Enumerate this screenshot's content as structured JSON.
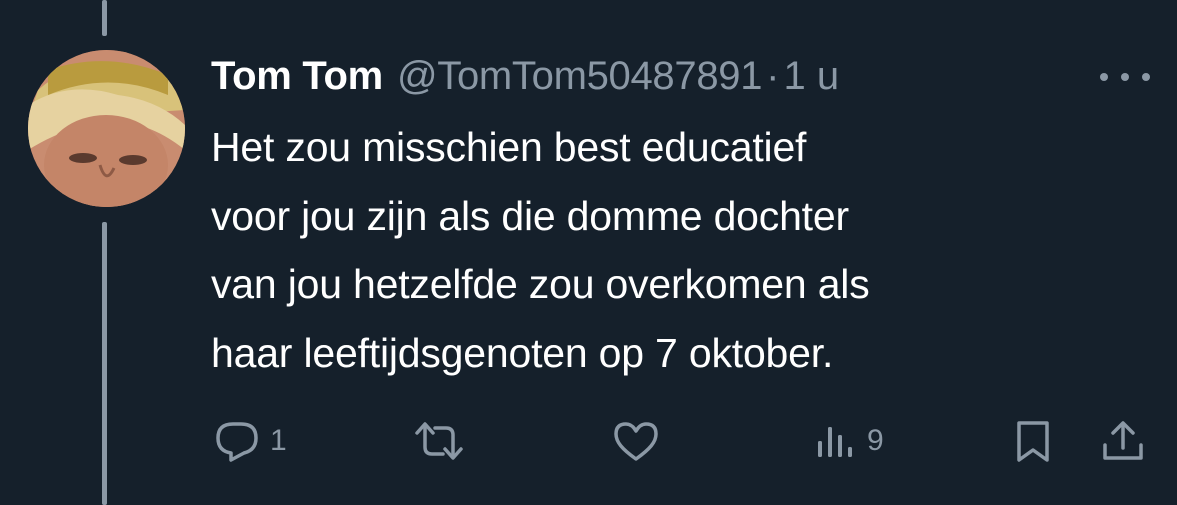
{
  "tweet": {
    "display_name": "Tom Tom",
    "handle": "@TomTom50487891",
    "separator": "·",
    "time": "1 u",
    "text_lines": [
      "Het zou misschien best educatief",
      "voor jou zijn als die domme dochter",
      "van jou hetzelfde zou overkomen als",
      "haar leeftijdsgenoten op 7 oktober."
    ]
  },
  "actions": {
    "reply_count": "1",
    "repost_count": "",
    "like_count": "",
    "views_count": "9"
  },
  "icons": {
    "reply": "reply-icon",
    "repost": "repost-icon",
    "like": "heart-icon",
    "views": "views-icon",
    "bookmark": "bookmark-icon",
    "share": "share-icon",
    "more": "more-icon"
  },
  "colors": {
    "background": "#15202b",
    "text_primary": "#ffffff",
    "text_secondary": "#8b98a5"
  }
}
